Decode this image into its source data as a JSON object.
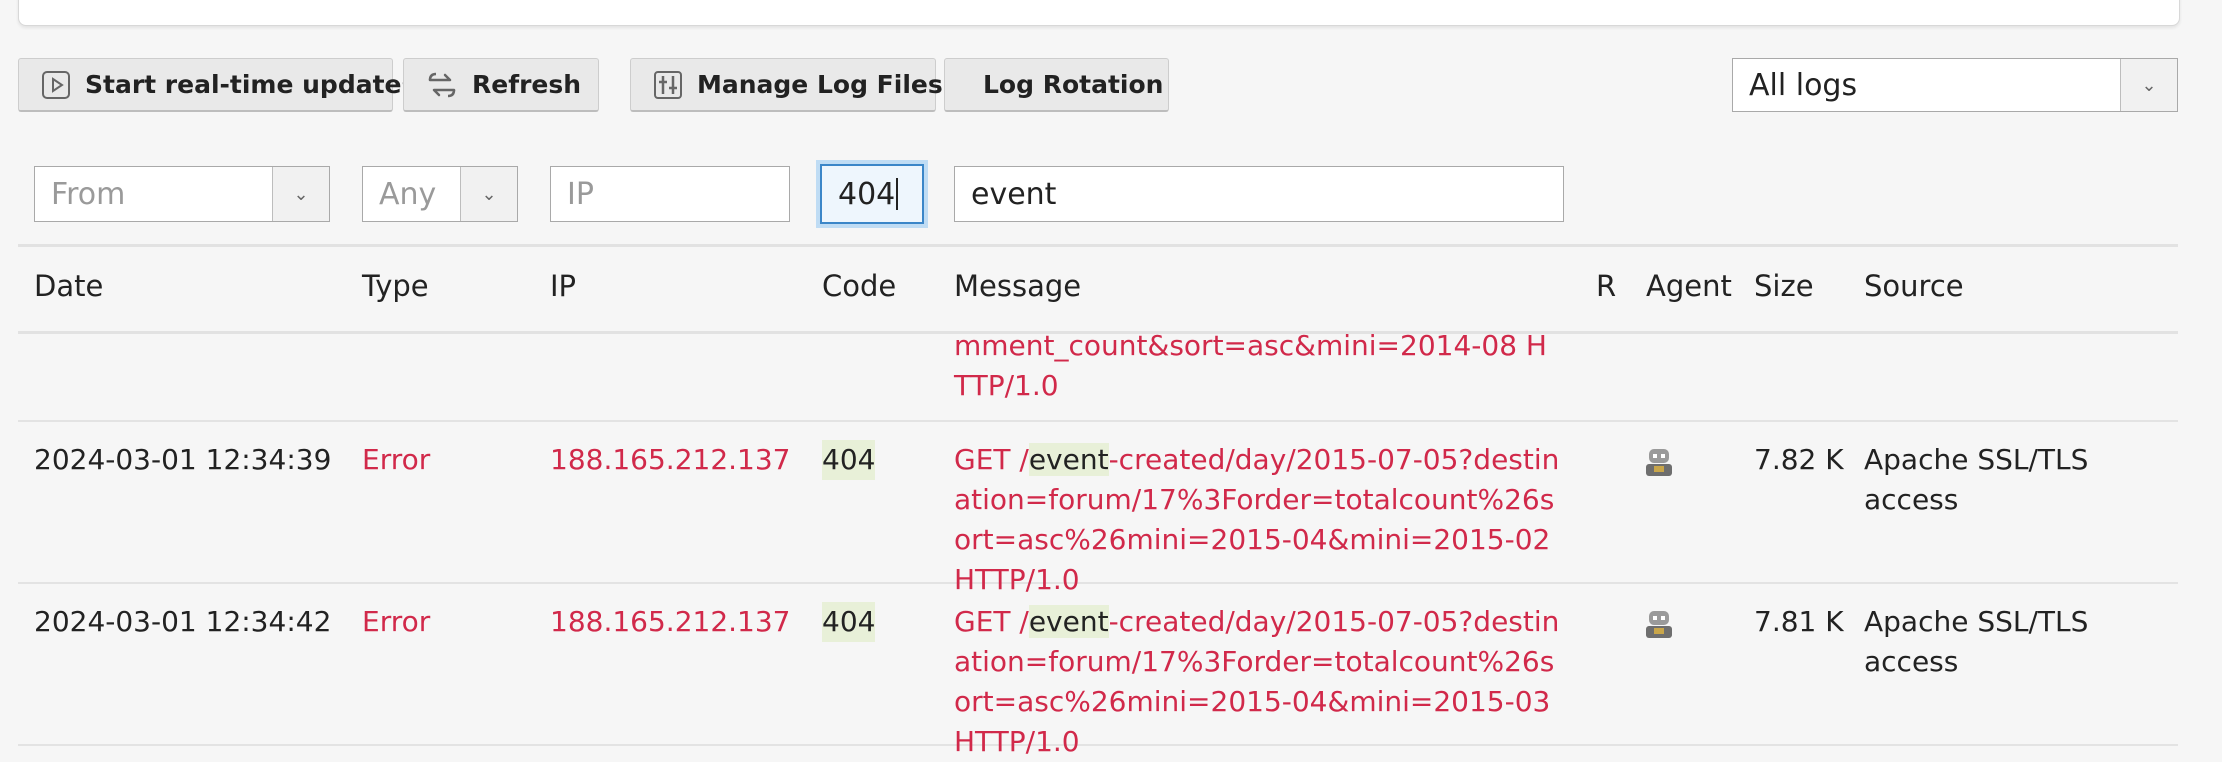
{
  "toolbar": {
    "realtime_label": "Start real-time updates",
    "refresh_label": "Refresh",
    "manage_label": "Manage Log Files",
    "rotation_label": "Log Rotation",
    "log_select_value": "All logs"
  },
  "filters": {
    "from_placeholder": "From",
    "type_placeholder": "Any",
    "ip_placeholder": "IP",
    "code_value": "404",
    "search_value": "event"
  },
  "columns": {
    "date": "Date",
    "type": "Type",
    "ip": "IP",
    "code": "Code",
    "message": "Message",
    "r": "R",
    "agent": "Agent",
    "size": "Size",
    "source": "Source"
  },
  "rows": [
    {
      "message_end": "mment_count&sort=asc&mini=2014-08 HTTP/1.0"
    },
    {
      "date": "2024-03-01 12:34:39",
      "type": "Error",
      "ip": "188.165.212.137",
      "code": "404",
      "msg_pre": "GET /",
      "msg_hl": "event",
      "msg_post": "-created/day/2015-07-05?destination=forum/17%3Forder=totalcount%26sort=asc%26mini=2015-04&mini=2015-02 HTTP/1.0",
      "agent_icon": "robot-icon",
      "size": "7.82 K",
      "source": "Apache SSL/TLS access"
    },
    {
      "date": "2024-03-01 12:34:42",
      "type": "Error",
      "ip": "188.165.212.137",
      "code": "404",
      "msg_pre": "GET /",
      "msg_hl": "event",
      "msg_post": "-created/day/2015-07-05?destination=forum/17%3Forder=totalcount%26sort=asc%26mini=2015-04&mini=2015-03 HTTP/1.0",
      "agent_icon": "robot-icon",
      "size": "7.81 K",
      "source": "Apache SSL/TLS access"
    }
  ]
}
